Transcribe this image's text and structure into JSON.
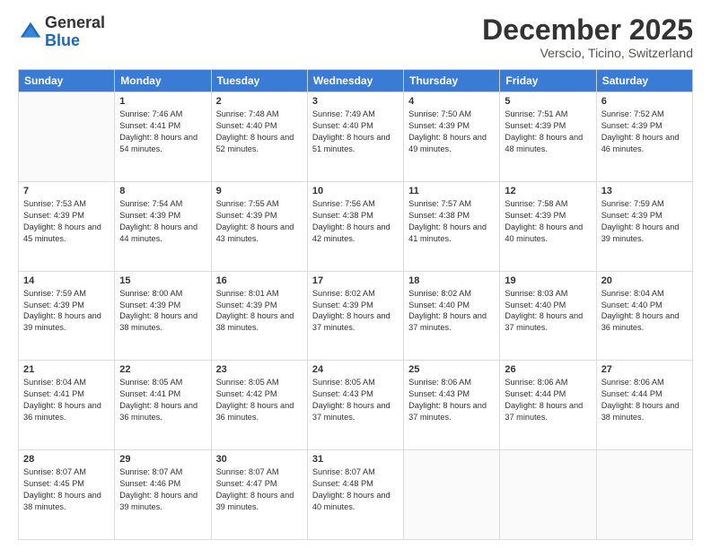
{
  "logo": {
    "general": "General",
    "blue": "Blue"
  },
  "title": "December 2025",
  "location": "Verscio, Ticino, Switzerland",
  "weekdays": [
    "Sunday",
    "Monday",
    "Tuesday",
    "Wednesday",
    "Thursday",
    "Friday",
    "Saturday"
  ],
  "days": [
    {
      "date": "",
      "sunrise": "",
      "sunset": "",
      "daylight": ""
    },
    {
      "date": "1",
      "sunrise": "7:46 AM",
      "sunset": "4:41 PM",
      "daylight": "8 hours and 54 minutes."
    },
    {
      "date": "2",
      "sunrise": "7:48 AM",
      "sunset": "4:40 PM",
      "daylight": "8 hours and 52 minutes."
    },
    {
      "date": "3",
      "sunrise": "7:49 AM",
      "sunset": "4:40 PM",
      "daylight": "8 hours and 51 minutes."
    },
    {
      "date": "4",
      "sunrise": "7:50 AM",
      "sunset": "4:39 PM",
      "daylight": "8 hours and 49 minutes."
    },
    {
      "date": "5",
      "sunrise": "7:51 AM",
      "sunset": "4:39 PM",
      "daylight": "8 hours and 48 minutes."
    },
    {
      "date": "6",
      "sunrise": "7:52 AM",
      "sunset": "4:39 PM",
      "daylight": "8 hours and 46 minutes."
    },
    {
      "date": "7",
      "sunrise": "7:53 AM",
      "sunset": "4:39 PM",
      "daylight": "8 hours and 45 minutes."
    },
    {
      "date": "8",
      "sunrise": "7:54 AM",
      "sunset": "4:39 PM",
      "daylight": "8 hours and 44 minutes."
    },
    {
      "date": "9",
      "sunrise": "7:55 AM",
      "sunset": "4:39 PM",
      "daylight": "8 hours and 43 minutes."
    },
    {
      "date": "10",
      "sunrise": "7:56 AM",
      "sunset": "4:38 PM",
      "daylight": "8 hours and 42 minutes."
    },
    {
      "date": "11",
      "sunrise": "7:57 AM",
      "sunset": "4:38 PM",
      "daylight": "8 hours and 41 minutes."
    },
    {
      "date": "12",
      "sunrise": "7:58 AM",
      "sunset": "4:39 PM",
      "daylight": "8 hours and 40 minutes."
    },
    {
      "date": "13",
      "sunrise": "7:59 AM",
      "sunset": "4:39 PM",
      "daylight": "8 hours and 39 minutes."
    },
    {
      "date": "14",
      "sunrise": "7:59 AM",
      "sunset": "4:39 PM",
      "daylight": "8 hours and 39 minutes."
    },
    {
      "date": "15",
      "sunrise": "8:00 AM",
      "sunset": "4:39 PM",
      "daylight": "8 hours and 38 minutes."
    },
    {
      "date": "16",
      "sunrise": "8:01 AM",
      "sunset": "4:39 PM",
      "daylight": "8 hours and 38 minutes."
    },
    {
      "date": "17",
      "sunrise": "8:02 AM",
      "sunset": "4:39 PM",
      "daylight": "8 hours and 37 minutes."
    },
    {
      "date": "18",
      "sunrise": "8:02 AM",
      "sunset": "4:40 PM",
      "daylight": "8 hours and 37 minutes."
    },
    {
      "date": "19",
      "sunrise": "8:03 AM",
      "sunset": "4:40 PM",
      "daylight": "8 hours and 37 minutes."
    },
    {
      "date": "20",
      "sunrise": "8:04 AM",
      "sunset": "4:40 PM",
      "daylight": "8 hours and 36 minutes."
    },
    {
      "date": "21",
      "sunrise": "8:04 AM",
      "sunset": "4:41 PM",
      "daylight": "8 hours and 36 minutes."
    },
    {
      "date": "22",
      "sunrise": "8:05 AM",
      "sunset": "4:41 PM",
      "daylight": "8 hours and 36 minutes."
    },
    {
      "date": "23",
      "sunrise": "8:05 AM",
      "sunset": "4:42 PM",
      "daylight": "8 hours and 36 minutes."
    },
    {
      "date": "24",
      "sunrise": "8:05 AM",
      "sunset": "4:43 PM",
      "daylight": "8 hours and 37 minutes."
    },
    {
      "date": "25",
      "sunrise": "8:06 AM",
      "sunset": "4:43 PM",
      "daylight": "8 hours and 37 minutes."
    },
    {
      "date": "26",
      "sunrise": "8:06 AM",
      "sunset": "4:44 PM",
      "daylight": "8 hours and 37 minutes."
    },
    {
      "date": "27",
      "sunrise": "8:06 AM",
      "sunset": "4:44 PM",
      "daylight": "8 hours and 38 minutes."
    },
    {
      "date": "28",
      "sunrise": "8:07 AM",
      "sunset": "4:45 PM",
      "daylight": "8 hours and 38 minutes."
    },
    {
      "date": "29",
      "sunrise": "8:07 AM",
      "sunset": "4:46 PM",
      "daylight": "8 hours and 39 minutes."
    },
    {
      "date": "30",
      "sunrise": "8:07 AM",
      "sunset": "4:47 PM",
      "daylight": "8 hours and 39 minutes."
    },
    {
      "date": "31",
      "sunrise": "8:07 AM",
      "sunset": "4:48 PM",
      "daylight": "8 hours and 40 minutes."
    }
  ],
  "labels": {
    "sunrise": "Sunrise:",
    "sunset": "Sunset:",
    "daylight": "Daylight:"
  }
}
